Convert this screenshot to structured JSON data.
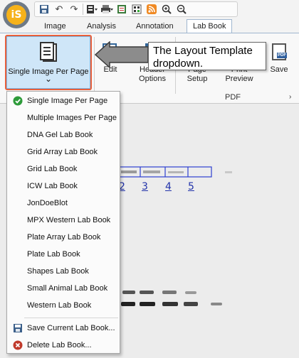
{
  "app": {
    "logo_text": "iS"
  },
  "quick_access": {
    "icons": [
      "save-icon",
      "undo-icon",
      "redo-icon",
      "layout-icon",
      "print-icon",
      "export-icon",
      "barcode-icon",
      "rss-icon",
      "zoom-in-icon",
      "zoom-out-icon"
    ]
  },
  "tabs": {
    "items": [
      "Image",
      "Analysis",
      "Annotation",
      "Lab Book"
    ],
    "active": "Lab Book"
  },
  "ribbon": {
    "layout_button": {
      "label": "Single Image Per Page",
      "chevron": "⌄"
    },
    "edit_label": "Edit",
    "header_label": "Header",
    "options_label": "Options",
    "page_label": "Page",
    "setup_label": "Setup",
    "print_label": "Print",
    "preview_label": "Preview",
    "save_label": "Save",
    "pdf_group": "PDF",
    "pdf_badge": "PDF"
  },
  "callout": {
    "text": "The Layout Template dropdown."
  },
  "lanes": [
    "2",
    "3",
    "4",
    "5"
  ],
  "menu": {
    "items": [
      {
        "label": "Single Image Per Page",
        "checked": true
      },
      {
        "label": "Multiple Images Per Page"
      },
      {
        "label": "DNA Gel Lab Book"
      },
      {
        "label": "Grid Array Lab Book"
      },
      {
        "label": "Grid Lab Book"
      },
      {
        "label": "ICW Lab Book"
      },
      {
        "label": "JonDoeBlot"
      },
      {
        "label": "MPX Western Lab Book"
      },
      {
        "label": "Plate Array Lab Book"
      },
      {
        "label": "Plate Lab Book"
      },
      {
        "label": "Shapes Lab Book"
      },
      {
        "label": "Small Animal Lab Book"
      },
      {
        "label": "Western Lab Book"
      }
    ],
    "save_current": "Save Current Lab Book...",
    "delete": "Delete Lab Book..."
  },
  "colors": {
    "accent": "#e8603c",
    "selected_bg": "#cfe6f8",
    "check_green": "#2e9b3a",
    "delete_red": "#c0392b"
  }
}
